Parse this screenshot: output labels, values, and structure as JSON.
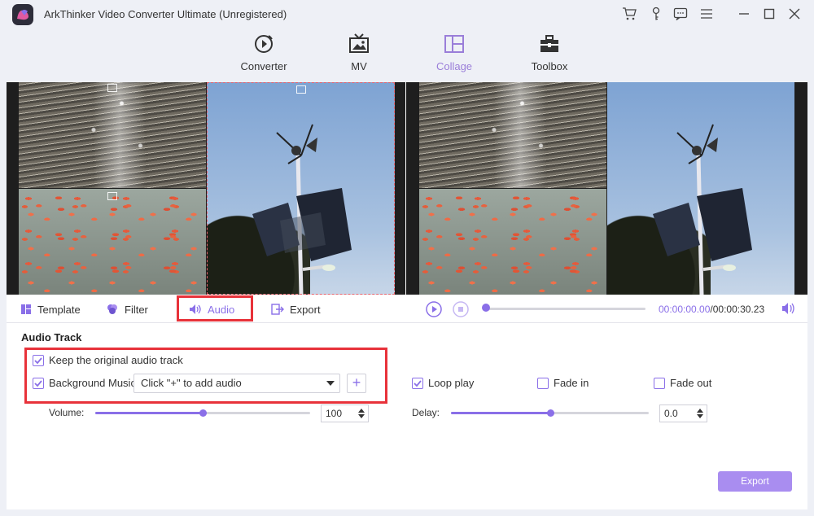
{
  "app": {
    "title": "ArkThinker Video Converter Ultimate (Unregistered)"
  },
  "titlebar_icons": [
    "cart-icon",
    "key-icon",
    "feedback-icon",
    "menu-icon",
    "minimize-icon",
    "maximize-icon",
    "close-icon"
  ],
  "nav": {
    "items": [
      {
        "label": "Converter",
        "icon": "converter-icon",
        "active": false
      },
      {
        "label": "MV",
        "icon": "mv-icon",
        "active": false
      },
      {
        "label": "Collage",
        "icon": "collage-icon",
        "active": true
      },
      {
        "label": "Toolbox",
        "icon": "toolbox-icon",
        "active": false
      }
    ]
  },
  "tabs": {
    "template": "Template",
    "filter": "Filter",
    "audio": "Audio",
    "export": "Export",
    "active": "Audio"
  },
  "player": {
    "current_time": "00:00:00.00",
    "total_time": "/00:00:30.23",
    "progress": 0
  },
  "audio": {
    "section_title": "Audio Track",
    "keep_original": {
      "label": "Keep the original audio track",
      "checked": true
    },
    "background_music": {
      "label": "Background Music",
      "checked": true,
      "select_value": "Click \"+\" to add audio",
      "add_label": "+"
    },
    "volume": {
      "label": "Volume:",
      "value": "100",
      "level": 0.5
    },
    "loop_play": {
      "label": "Loop play",
      "checked": true
    },
    "fade_in": {
      "label": "Fade in",
      "checked": false
    },
    "fade_out": {
      "label": "Fade out",
      "checked": false
    },
    "delay": {
      "label": "Delay:",
      "value": "0.0",
      "level": 0.5
    }
  },
  "export_button": "Export",
  "colors": {
    "accent": "#8a6fe8",
    "highlight": "#e8323a",
    "export_bg": "#a98df0"
  }
}
